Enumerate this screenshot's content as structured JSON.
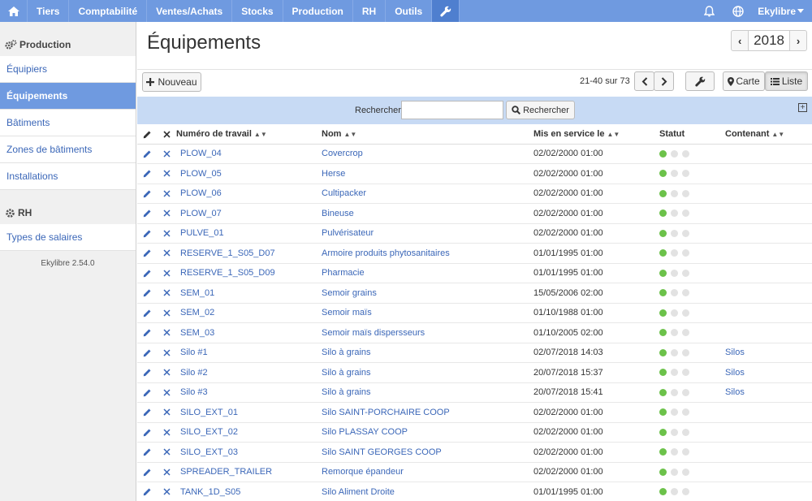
{
  "nav": {
    "items": [
      "Tiers",
      "Comptabilité",
      "Ventes/Achats",
      "Stocks",
      "Production",
      "RH",
      "Outils"
    ],
    "user": "Ekylibre"
  },
  "sidebar": {
    "production_title": "Production",
    "production_items": [
      "Équipiers",
      "Équipements",
      "Bâtiments",
      "Zones de bâtiments",
      "Installations"
    ],
    "rh_title": "RH",
    "rh_items": [
      "Types de salaires"
    ],
    "version": "Ekylibre 2.54.0"
  },
  "page": {
    "title": "Équipements",
    "year": "2018",
    "new_label": "Nouveau",
    "pagination": "21-40 sur 73",
    "view_map": "Carte",
    "view_list": "Liste",
    "search_label": "Rechercher",
    "search_value": "",
    "search_button": "Rechercher"
  },
  "table": {
    "columns": [
      "Numéro de travail",
      "Nom",
      "Mis en service le",
      "Statut",
      "Contenant"
    ],
    "rows": [
      {
        "num": "PLOW_04",
        "nom": "Covercrop",
        "date": "02/02/2000 01:00",
        "status": 1,
        "cont": ""
      },
      {
        "num": "PLOW_05",
        "nom": "Herse",
        "date": "02/02/2000 01:00",
        "status": 1,
        "cont": ""
      },
      {
        "num": "PLOW_06",
        "nom": "Cultipacker",
        "date": "02/02/2000 01:00",
        "status": 1,
        "cont": ""
      },
      {
        "num": "PLOW_07",
        "nom": "Bineuse",
        "date": "02/02/2000 01:00",
        "status": 1,
        "cont": ""
      },
      {
        "num": "PULVE_01",
        "nom": "Pulvérisateur",
        "date": "02/02/2000 01:00",
        "status": 1,
        "cont": ""
      },
      {
        "num": "RESERVE_1_S05_D07",
        "nom": "Armoire produits phytosanitaires",
        "date": "01/01/1995 01:00",
        "status": 1,
        "cont": ""
      },
      {
        "num": "RESERVE_1_S05_D09",
        "nom": "Pharmacie",
        "date": "01/01/1995 01:00",
        "status": 1,
        "cont": ""
      },
      {
        "num": "SEM_01",
        "nom": "Semoir grains",
        "date": "15/05/2006 02:00",
        "status": 1,
        "cont": ""
      },
      {
        "num": "SEM_02",
        "nom": "Semoir maïs",
        "date": "01/10/1988 01:00",
        "status": 1,
        "cont": ""
      },
      {
        "num": "SEM_03",
        "nom": "Semoir maïs dispersseurs",
        "date": "01/10/2005 02:00",
        "status": 1,
        "cont": ""
      },
      {
        "num": "Silo #1",
        "nom": "Silo à grains",
        "date": "02/07/2018 14:03",
        "status": 1,
        "cont": "Silos"
      },
      {
        "num": "Silo #2",
        "nom": "Silo à grains",
        "date": "20/07/2018 15:37",
        "status": 1,
        "cont": "Silos"
      },
      {
        "num": "Silo #3",
        "nom": "Silo à grains",
        "date": "20/07/2018 15:41",
        "status": 1,
        "cont": "Silos"
      },
      {
        "num": "SILO_EXT_01",
        "nom": "Silo SAINT-PORCHAIRE COOP",
        "date": "02/02/2000 01:00",
        "status": 1,
        "cont": ""
      },
      {
        "num": "SILO_EXT_02",
        "nom": "Silo PLASSAY COOP",
        "date": "02/02/2000 01:00",
        "status": 1,
        "cont": ""
      },
      {
        "num": "SILO_EXT_03",
        "nom": "Silo SAINT GEORGES COOP",
        "date": "02/02/2000 01:00",
        "status": 1,
        "cont": ""
      },
      {
        "num": "SPREADER_TRAILER",
        "nom": "Remorque épandeur",
        "date": "02/02/2000 01:00",
        "status": 1,
        "cont": ""
      },
      {
        "num": "TANK_1D_S05",
        "nom": "Silo Aliment Droite",
        "date": "01/01/1995 01:00",
        "status": 1,
        "cont": ""
      }
    ]
  },
  "colors": {
    "nav_bg": "#6f9ae0",
    "link": "#3b67b8",
    "search_bg": "#c7daf4",
    "status_ok": "#6cc24a",
    "status_off": "#e2e2e2"
  }
}
